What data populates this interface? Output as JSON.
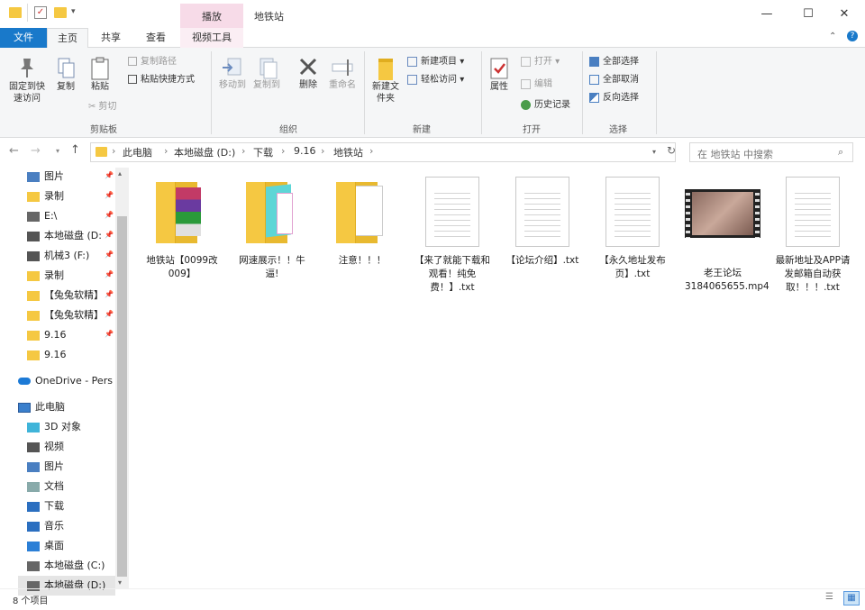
{
  "title_bar": {
    "play_tab": "播放",
    "window_title": "地铁站",
    "minimize": "—",
    "maximize": "☐",
    "close": "✕"
  },
  "tabs": {
    "file": "文件",
    "home": "主页",
    "share": "共享",
    "view": "查看",
    "video_tools": "视频工具"
  },
  "ribbon": {
    "pin_label": "固定到快速访问",
    "copy_label": "复制",
    "paste_label": "粘贴",
    "copy_path": "复制路径",
    "paste_shortcut": "粘贴快捷方式",
    "cut": "剪切",
    "clipboard_group": "剪贴板",
    "move_to": "移动到",
    "copy_to": "复制到",
    "delete": "删除",
    "rename": "重命名",
    "organize_group": "组织",
    "new_folder": "新建文件夹",
    "new_item": "新建项目",
    "easy_access": "轻松访问",
    "new_group": "新建",
    "properties": "属性",
    "open": "打开",
    "edit": "编辑",
    "history": "历史记录",
    "open_group": "打开",
    "select_all": "全部选择",
    "select_none": "全部取消",
    "invert_selection": "反向选择",
    "select_group": "选择"
  },
  "address": {
    "crumbs": [
      "此电脑",
      "本地磁盘 (D:)",
      "下载",
      "9.16",
      "地铁站"
    ],
    "search_placeholder": "在 地铁站 中搜索"
  },
  "nav": {
    "quick": [
      {
        "label": "图片",
        "pinned": true
      },
      {
        "label": "录制",
        "pinned": true
      },
      {
        "label": "E:\\",
        "pinned": true
      },
      {
        "label": "本地磁盘 (D:",
        "pinned": true
      },
      {
        "label": "机械3 (F:)",
        "pinned": true
      },
      {
        "label": "录制",
        "pinned": true
      },
      {
        "label": "【兔兔软精】",
        "pinned": true
      },
      {
        "label": "【兔兔软精】",
        "pinned": true
      },
      {
        "label": "9.16",
        "pinned": true
      },
      {
        "label": "9.16",
        "pinned": false
      }
    ],
    "onedrive": "OneDrive - Pers",
    "this_pc": "此电脑",
    "pc_items": [
      "3D 对象",
      "视频",
      "图片",
      "文档",
      "下载",
      "音乐",
      "桌面",
      "本地磁盘 (C:)",
      "本地磁盘 (D:)"
    ]
  },
  "files": [
    {
      "name": "地铁站【0099改009】",
      "kind": "folder-colored"
    },
    {
      "name": "网速展示！！牛逼!",
      "kind": "folder-teal"
    },
    {
      "name": "注意！！！",
      "kind": "folder-white"
    },
    {
      "name": "【来了就能下载和观看！纯免费！】.txt",
      "kind": "txt"
    },
    {
      "name": "【论坛介绍】.txt",
      "kind": "txt"
    },
    {
      "name": "【永久地址发布页】.txt",
      "kind": "txt"
    },
    {
      "name": "老王论坛3184065655.mp4",
      "kind": "video"
    },
    {
      "name": "最新地址及APP请发邮箱自动获取！！！.txt",
      "kind": "txt"
    }
  ],
  "status": {
    "count": "8 个项目"
  },
  "colors": {
    "accent": "#1979ca",
    "folder": "#f5c842",
    "play_tab": "#f7dbe8"
  }
}
